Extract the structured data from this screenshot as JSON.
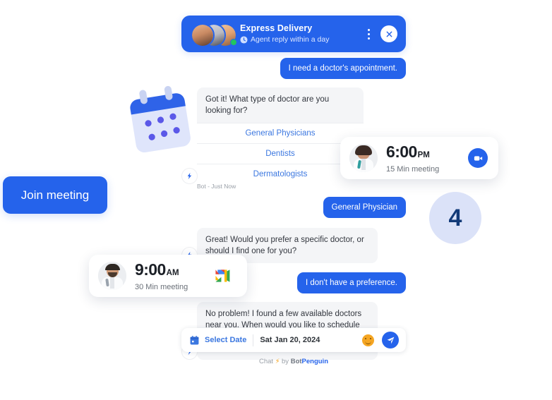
{
  "header": {
    "title": "Express Delivery",
    "subtitle": "Agent reply within a day",
    "clock_icon": "clock-icon",
    "menu_icon": "kebab-menu-icon",
    "close_icon": "close-icon",
    "online_status": "online",
    "accent_color": "#2563eb"
  },
  "messages": [
    {
      "id": "m1",
      "sender": "user",
      "text": "I need a doctor's appointment."
    },
    {
      "id": "m2",
      "sender": "bot",
      "type": "options",
      "text": "Got it! What type of doctor are you looking for?",
      "options": [
        "General Physicians",
        "Dentists",
        "Dermatologists"
      ],
      "meta": "Bot - Just Now"
    },
    {
      "id": "m3",
      "sender": "user",
      "text": "General Physician"
    },
    {
      "id": "m4",
      "sender": "bot",
      "text": "Great! Would you prefer a specific doctor, or should I find one for you?"
    },
    {
      "id": "m5",
      "sender": "user",
      "text": "I don't have a preference."
    },
    {
      "id": "m6",
      "sender": "bot",
      "text": "No problem! I found a few available doctors near you. When would you like to schedule the appointment? You can pick a date and time."
    }
  ],
  "composer": {
    "calendar_icon": "calendar-icon",
    "select_date_label": "Select Date",
    "date_value": "Sat Jan 20, 2024",
    "emoji_icon": "smiley-icon",
    "send_icon": "send-icon"
  },
  "branding": {
    "prefix": "Chat",
    "bolt": "⚡",
    "by": "by",
    "brand_first": "Bot",
    "brand_second": "Penguin"
  },
  "meeting_cards": [
    {
      "id": "card-600",
      "time": "6:00",
      "meridiem": "PM",
      "duration": "15 Min meeting",
      "avatar": "female-doctor-avatar",
      "platform_icon": "zoom-icon"
    },
    {
      "id": "card-900",
      "time": "9:00",
      "meridiem": "AM",
      "duration": "30 Min meeting",
      "avatar": "male-doctor-avatar",
      "platform_icon": "google-meet-icon"
    }
  ],
  "decorations": {
    "join_meeting_label": "Join meeting",
    "badge_count": "4",
    "calendar_illustration": "calendar-illustration"
  }
}
